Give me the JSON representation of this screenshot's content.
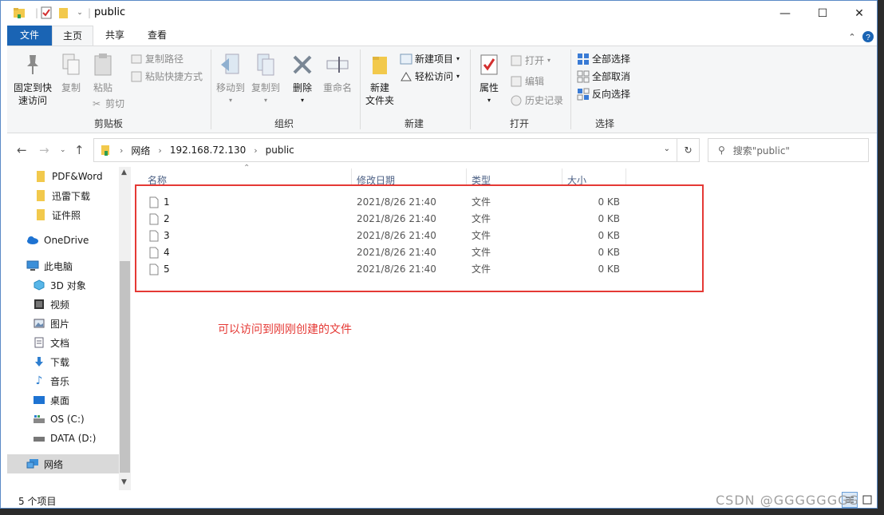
{
  "window": {
    "title": "public",
    "controls": {
      "minimize": "—",
      "maximize": "☐",
      "close": "✕"
    }
  },
  "ribbon_tabs": [
    "文件",
    "主页",
    "共享",
    "查看"
  ],
  "ribbon": {
    "clipboard": {
      "label": "剪贴板",
      "pin_line1": "固定到快",
      "pin_line2": "速访问",
      "copy": "复制",
      "paste": "粘贴",
      "copy_path": "复制路径",
      "paste_shortcut": "粘贴快捷方式",
      "cut": "剪切"
    },
    "organize": {
      "label": "组织",
      "move_to": "移动到",
      "copy_to": "复制到",
      "delete": "删除",
      "rename": "重命名"
    },
    "new": {
      "label": "新建",
      "new_folder_line1": "新建",
      "new_folder_line2": "文件夹",
      "new_item": "新建项目",
      "easy_access": "轻松访问"
    },
    "open": {
      "label": "打开",
      "properties": "属性",
      "open": "打开",
      "edit": "编辑",
      "history": "历史记录"
    },
    "select": {
      "label": "选择",
      "select_all": "全部选择",
      "select_none": "全部取消",
      "invert": "反向选择"
    }
  },
  "address": {
    "crumbs": [
      "网络",
      "192.168.72.130",
      "public"
    ],
    "search_placeholder": "搜索\"public\""
  },
  "sidebar": {
    "items": [
      {
        "label": "PDF&Word",
        "icon": "folder-icon"
      },
      {
        "label": "迅雷下载",
        "icon": "folder-icon"
      },
      {
        "label": "证件照",
        "icon": "folder-icon"
      },
      {
        "label": "OneDrive",
        "icon": "cloud-icon"
      },
      {
        "label": "此电脑",
        "icon": "computer-icon"
      },
      {
        "label": "3D 对象",
        "icon": "cube-icon"
      },
      {
        "label": "视频",
        "icon": "video-icon"
      },
      {
        "label": "图片",
        "icon": "picture-icon"
      },
      {
        "label": "文档",
        "icon": "document-icon"
      },
      {
        "label": "下载",
        "icon": "download-icon"
      },
      {
        "label": "音乐",
        "icon": "music-icon"
      },
      {
        "label": "桌面",
        "icon": "desktop-icon"
      },
      {
        "label": "OS (C:)",
        "icon": "drive-icon"
      },
      {
        "label": "DATA (D:)",
        "icon": "drive-icon"
      },
      {
        "label": "网络",
        "icon": "network-icon"
      }
    ]
  },
  "filelist": {
    "columns": [
      "名称",
      "修改日期",
      "类型",
      "大小"
    ],
    "rows": [
      {
        "name": "1",
        "date": "2021/8/26 21:40",
        "type": "文件",
        "size": "0 KB"
      },
      {
        "name": "2",
        "date": "2021/8/26 21:40",
        "type": "文件",
        "size": "0 KB"
      },
      {
        "name": "3",
        "date": "2021/8/26 21:40",
        "type": "文件",
        "size": "0 KB"
      },
      {
        "name": "4",
        "date": "2021/8/26 21:40",
        "type": "文件",
        "size": "0 KB"
      },
      {
        "name": "5",
        "date": "2021/8/26 21:40",
        "type": "文件",
        "size": "0 KB"
      }
    ]
  },
  "annotation": "可以访问到刚刚创建的文件",
  "status": {
    "item_count": "5 个项目"
  },
  "watermark": "CSDN @GGGGGGGG",
  "colors": {
    "file_tab": "#1a64b4",
    "annotation": "#e53935",
    "selection_box": "#e53935",
    "column_header": "#4d6185"
  }
}
